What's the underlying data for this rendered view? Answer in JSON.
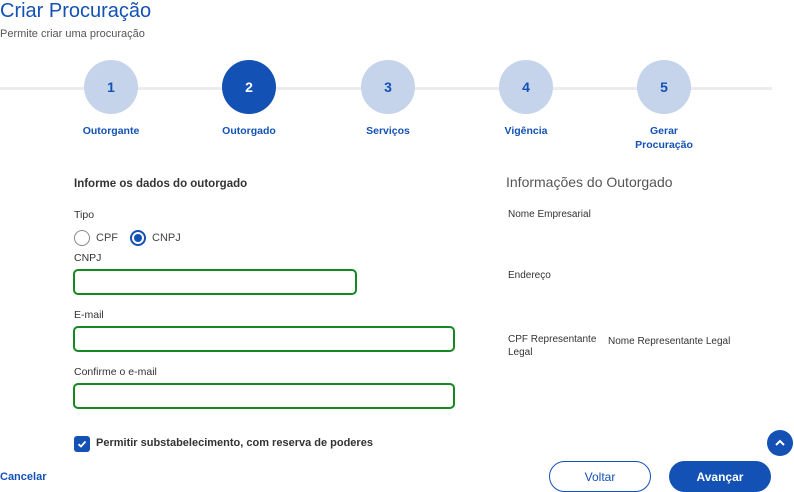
{
  "header": {
    "title": "Criar Procuração",
    "subtitle": "Permite criar uma procuração"
  },
  "steps": [
    {
      "number": "1",
      "label": "Outorgante",
      "active": false
    },
    {
      "number": "2",
      "label": "Outorgado",
      "active": true
    },
    {
      "number": "3",
      "label": "Serviços",
      "active": false
    },
    {
      "number": "4",
      "label": "Vigência",
      "active": false
    },
    {
      "number": "5",
      "label": "Gerar Procuração",
      "active": false
    }
  ],
  "form": {
    "section_title": "Informe os dados do outorgado",
    "tipo_label": "Tipo",
    "radio_cpf": "CPF",
    "radio_cnpj": "CNPJ",
    "selected_tipo": "CNPJ",
    "cnpj_label": "CNPJ",
    "cnpj_value": "",
    "email_label": "E-mail",
    "email_value": "",
    "confirm_email_label": "Confirme o e-mail",
    "confirm_email_value": "",
    "substabelecimento_label": "Permitir substabelecimento, com reserva de poderes",
    "substabelecimento_checked": true
  },
  "info": {
    "title": "Informações do Outorgado",
    "nome_empresarial_label": "Nome Empresarial",
    "endereco_label": "Endereço",
    "cpf_representante_label": "CPF Representante Legal",
    "nome_representante_label": "Nome Representante Legal"
  },
  "actions": {
    "cancel_label": "Cancelar",
    "back_label": "Voltar",
    "next_label": "Avançar"
  },
  "colors": {
    "primary": "#1351b4",
    "step_inactive": "#c5d4eb",
    "input_valid_border": "#168821"
  },
  "icons": {
    "scroll_top": "chevron-up-icon",
    "checkbox": "check-icon"
  }
}
